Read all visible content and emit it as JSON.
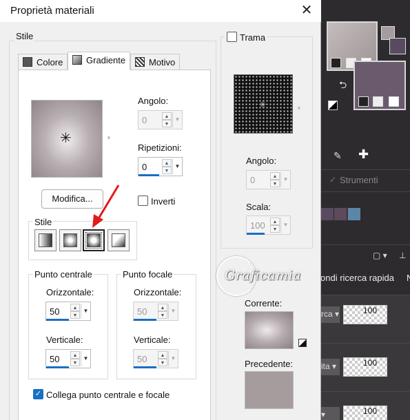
{
  "dialog": {
    "title": "Proprietà materiali",
    "close_glyph": "✕"
  },
  "stile_group": {
    "label": "Stile"
  },
  "tabs": [
    {
      "label": "Colore",
      "icon": "color-icon",
      "active": false
    },
    {
      "label": "Gradiente",
      "icon": "gradient-icon",
      "active": true
    },
    {
      "label": "Motivo",
      "icon": "pattern-icon",
      "active": false
    }
  ],
  "gradient": {
    "angolo_label": "Angolo:",
    "angolo_value": "0",
    "ripetizioni_label": "Ripetizioni:",
    "ripetizioni_value": "0",
    "modifica_label": "Modifica...",
    "inverti_label": "Inverti",
    "stile_label": "Stile",
    "style_buttons": [
      "linear-gradient-icon",
      "rectangular-gradient-icon",
      "sunburst-gradient-icon",
      "radial-gradient-icon"
    ],
    "active_style_index": 2,
    "punto_centrale": {
      "label": "Punto centrale",
      "orizzontale_label": "Orizzontale:",
      "orizzontale_value": "50",
      "verticale_label": "Verticale:",
      "verticale_value": "50"
    },
    "punto_focale": {
      "label": "Punto focale",
      "orizzontale_label": "Orizzontale:",
      "orizzontale_value": "50",
      "verticale_label": "Verticale:",
      "verticale_value": "50"
    },
    "collega_label": "Collega punto centrale e focale",
    "collega_checked": true
  },
  "trama": {
    "label": "Trama",
    "checked": false,
    "angolo_label": "Angolo:",
    "angolo_value": "0",
    "scala_label": "Scala:",
    "scala_value": "100"
  },
  "preview": {
    "corrente_label": "Corrente:",
    "precedente_label": "Precedente:"
  },
  "watermark": {
    "text": "Graficamia"
  },
  "background_app": {
    "strumenti_label": "Strumenti",
    "ricerca_label": "ondi ricerca rapida",
    "row_values": [
      "100",
      "100",
      "100"
    ],
    "combo_labels": [
      "rca",
      "ita",
      ""
    ],
    "palette_colors": [
      "#5a4a60",
      "#5d4a5b",
      "#4a3a55",
      "#5a86a8"
    ]
  },
  "colors": {
    "accent": "#1a6fc2",
    "swatch_gray": "#a69c9d",
    "swatch_purple": "#6b5a6e",
    "arrow_red": "#e21a1a"
  }
}
